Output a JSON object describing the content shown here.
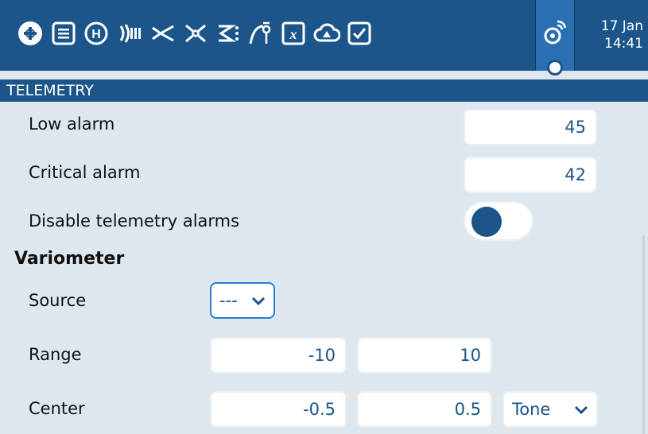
{
  "topbar": {
    "clock": {
      "date": "17 Jan",
      "time": "14:41"
    },
    "tabs": [
      {
        "icon": "plus-icon"
      },
      {
        "icon": "list-icon"
      },
      {
        "icon": "heli-icon"
      },
      {
        "icon": "signal-icon"
      },
      {
        "icon": "mixer-icon"
      },
      {
        "icon": "servo-icon"
      },
      {
        "icon": "logic-icon"
      },
      {
        "icon": "curve-icon"
      },
      {
        "icon": "variable-icon"
      },
      {
        "icon": "cloud-icon"
      },
      {
        "icon": "checklist-icon"
      },
      {
        "icon": "telemetry-icon"
      }
    ]
  },
  "section": {
    "title": "TELEMETRY"
  },
  "low_alarm": {
    "label": "Low alarm",
    "value": "45"
  },
  "critical_alarm": {
    "label": "Critical alarm",
    "value": "42"
  },
  "disable_alarms": {
    "label": "Disable telemetry alarms",
    "enabled": true
  },
  "variometer": {
    "title": "Variometer",
    "source": {
      "label": "Source",
      "value": "---"
    },
    "range": {
      "label": "Range",
      "min": "-10",
      "max": "10"
    },
    "center": {
      "label": "Center",
      "min": "-0.5",
      "max": "0.5",
      "mode": "Tone"
    }
  },
  "colors": {
    "accent": "#1b5589",
    "background": "#dfe7ee"
  }
}
